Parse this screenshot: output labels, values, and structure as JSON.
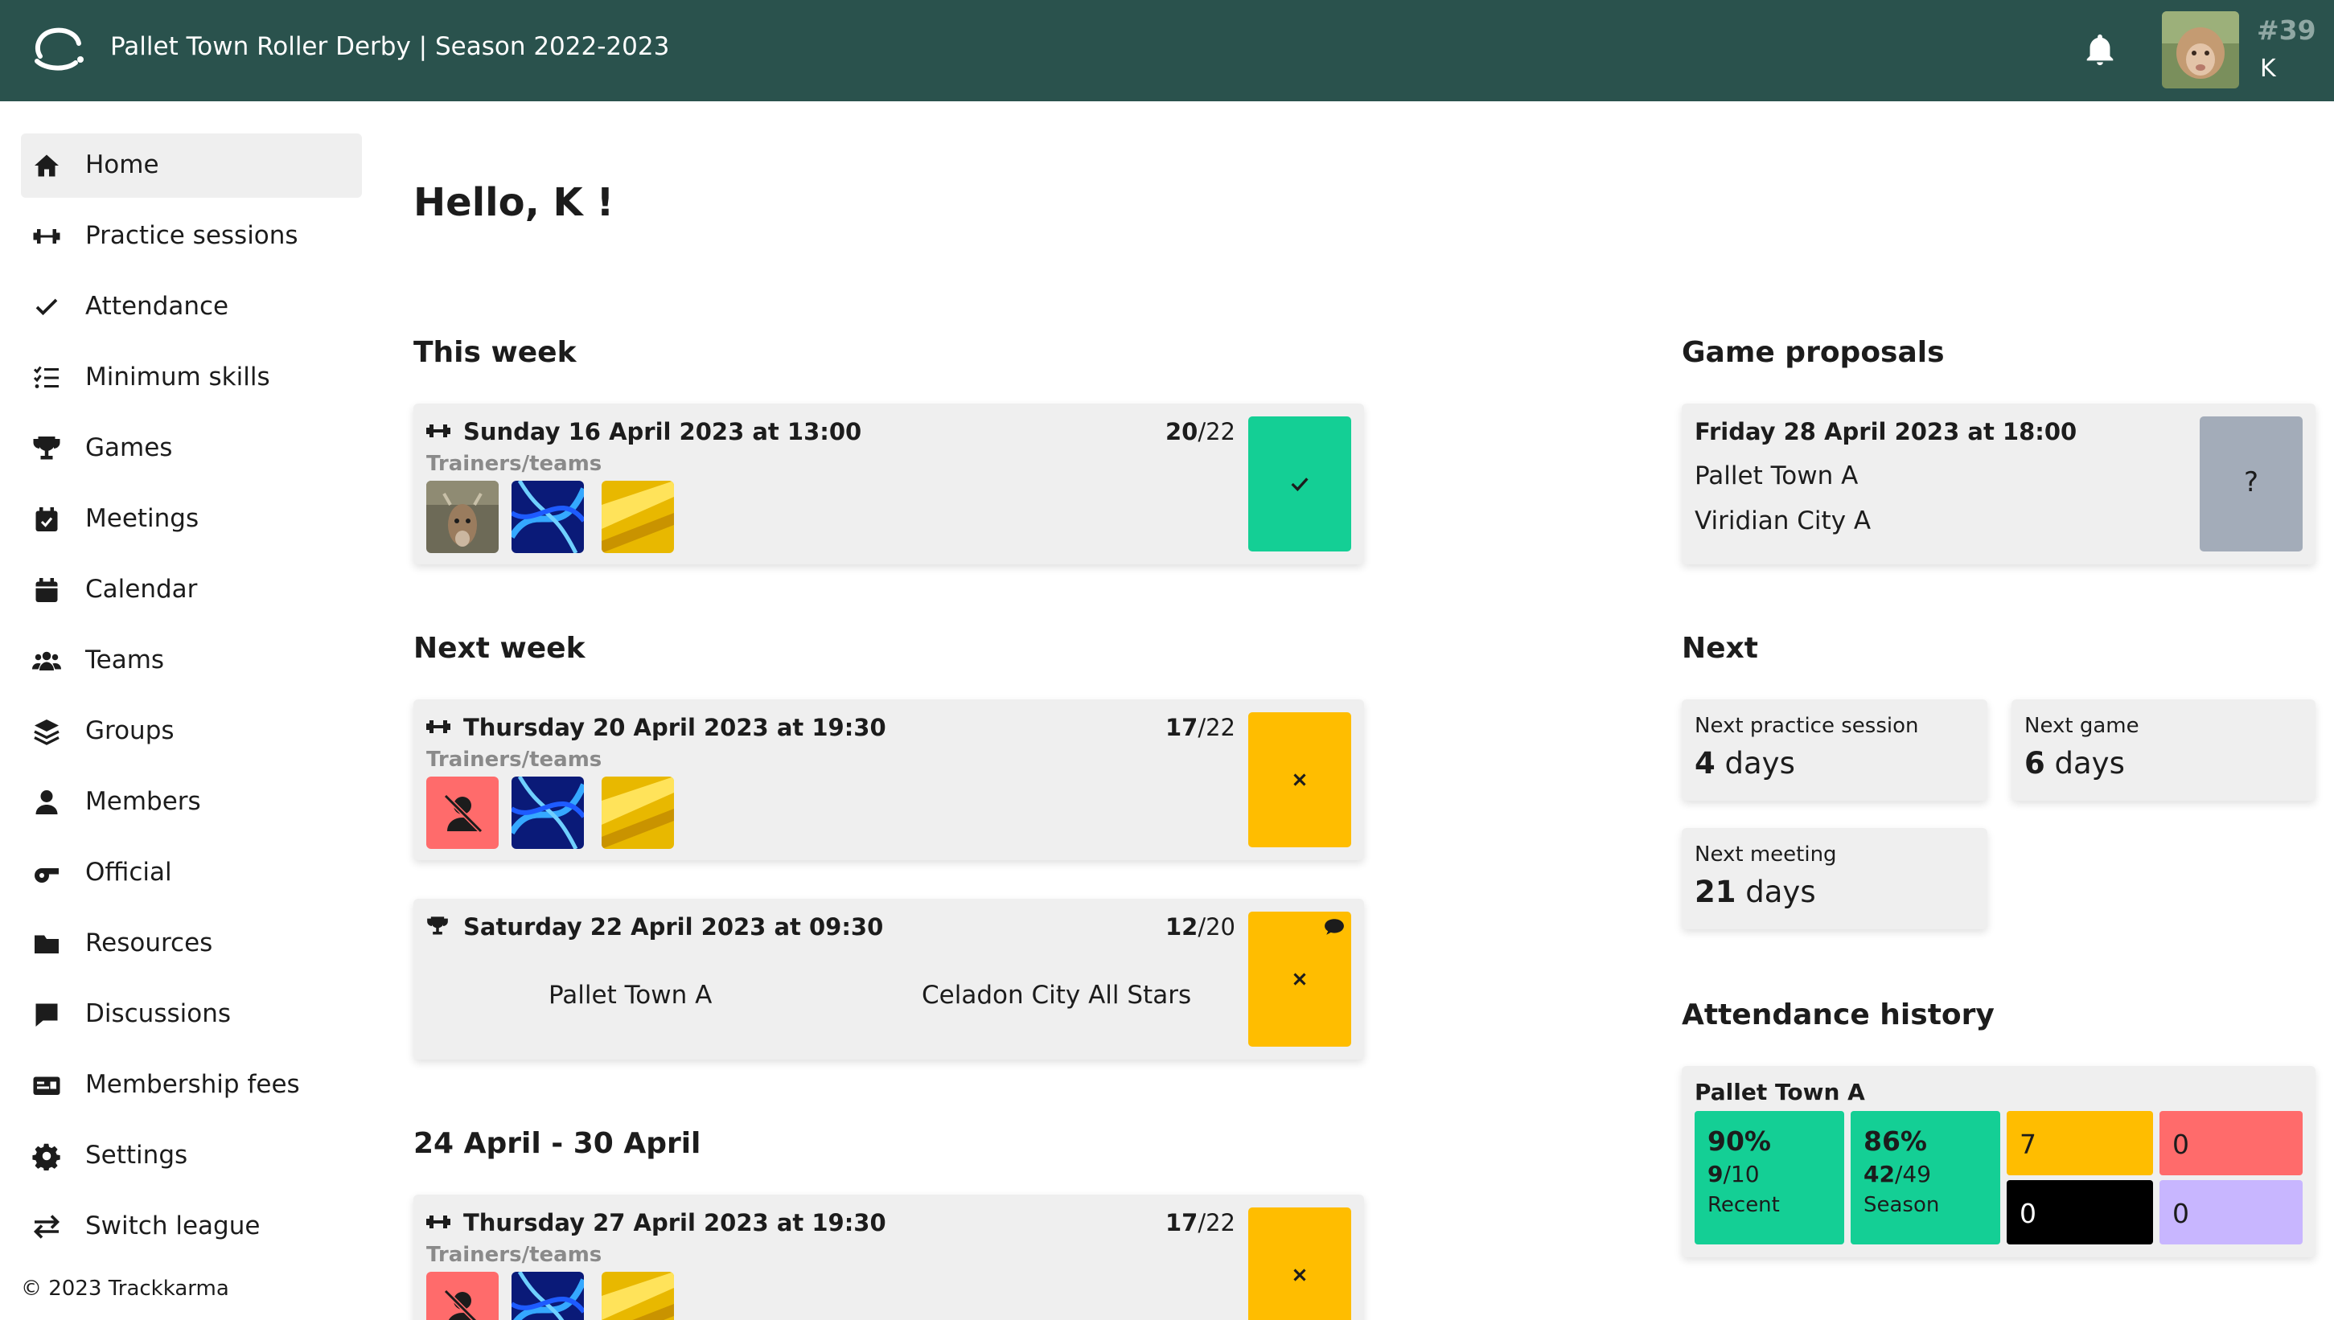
{
  "header": {
    "title": "Pallet Town Roller Derby | Season 2022-2023",
    "user_number": "#39",
    "user_initial": "K",
    "color": "#2a524d"
  },
  "sidebar": {
    "items": [
      {
        "label": "Home",
        "icon": "home-icon",
        "active": true
      },
      {
        "label": "Practice sessions",
        "icon": "dumbbell-icon"
      },
      {
        "label": "Attendance",
        "icon": "check-icon"
      },
      {
        "label": "Minimum skills",
        "icon": "checklist-icon"
      },
      {
        "label": "Games",
        "icon": "trophy-icon"
      },
      {
        "label": "Meetings",
        "icon": "calendar-check-icon"
      },
      {
        "label": "Calendar",
        "icon": "calendar-icon"
      },
      {
        "label": "Teams",
        "icon": "users-icon"
      },
      {
        "label": "Groups",
        "icon": "layers-icon"
      },
      {
        "label": "Members",
        "icon": "user-icon"
      },
      {
        "label": "Official",
        "icon": "whistle-icon"
      },
      {
        "label": "Resources",
        "icon": "folder-icon"
      },
      {
        "label": "Discussions",
        "icon": "comment-icon"
      },
      {
        "label": "Membership fees",
        "icon": "id-card-icon"
      },
      {
        "label": "Settings",
        "icon": "gear-icon"
      },
      {
        "label": "Switch league",
        "icon": "switch-icon"
      }
    ],
    "copyright": "© 2023 Trackkarma"
  },
  "main": {
    "greeting": "Hello, K !",
    "sections": [
      {
        "heading": "This week"
      },
      {
        "heading": "Next week"
      },
      {
        "heading": "24 April - 30 April"
      }
    ],
    "events": [
      {
        "type": "practice",
        "type_icon": "dumbbell-icon",
        "date": "Sunday 16 April 2023 at 13:00",
        "count_a": "20",
        "count_b": "/22",
        "subtitle": "Trainers/teams",
        "status": "present",
        "status_color": "#14cf95"
      },
      {
        "type": "practice",
        "type_icon": "dumbbell-icon",
        "date": "Thursday 20 April 2023 at 19:30",
        "count_a": "17",
        "count_b": "/22",
        "subtitle": "Trainers/teams",
        "status": "absent",
        "status_color": "#ffbd00"
      },
      {
        "type": "game",
        "type_icon": "trophy-icon",
        "date": "Saturday 22 April 2023 at 09:30",
        "count_a": "12",
        "count_b": "/20",
        "team_home": "Pallet Town A",
        "team_away": "Celadon City All Stars",
        "status": "absent",
        "status_color": "#ffbd00"
      },
      {
        "type": "practice",
        "type_icon": "dumbbell-icon",
        "date": "Thursday 27 April 2023 at 19:30",
        "count_a": "17",
        "count_b": "/22",
        "subtitle": "Trainers/teams",
        "status": "absent",
        "status_color": "#ffbd00"
      }
    ]
  },
  "right": {
    "proposals_heading": "Game proposals",
    "proposal": {
      "date": "Friday 28 April 2023 at 18:00",
      "team1": "Pallet Town A",
      "team2": "Viridian City A",
      "button": "?"
    },
    "next_heading": "Next",
    "next": [
      {
        "label": "Next practice session",
        "value": "4",
        "unit": " days"
      },
      {
        "label": "Next game",
        "value": "6",
        "unit": " days"
      },
      {
        "label": "Next meeting",
        "value": "21",
        "unit": " days"
      }
    ],
    "history_heading": "Attendance history",
    "history": {
      "team": "Pallet Town A",
      "recent": {
        "pct": "90%",
        "num": "9",
        "den": "/10",
        "caption": "Recent"
      },
      "season": {
        "pct": "86%",
        "num": "42",
        "den": "/49",
        "caption": "Season"
      },
      "counts": [
        "7",
        "0",
        "0",
        "0"
      ],
      "colors": {
        "green": "#14cf95",
        "yellow": "#ffbd00",
        "red": "#ff6b6b",
        "black": "#000000",
        "purple": "#c8b6ff"
      }
    }
  }
}
